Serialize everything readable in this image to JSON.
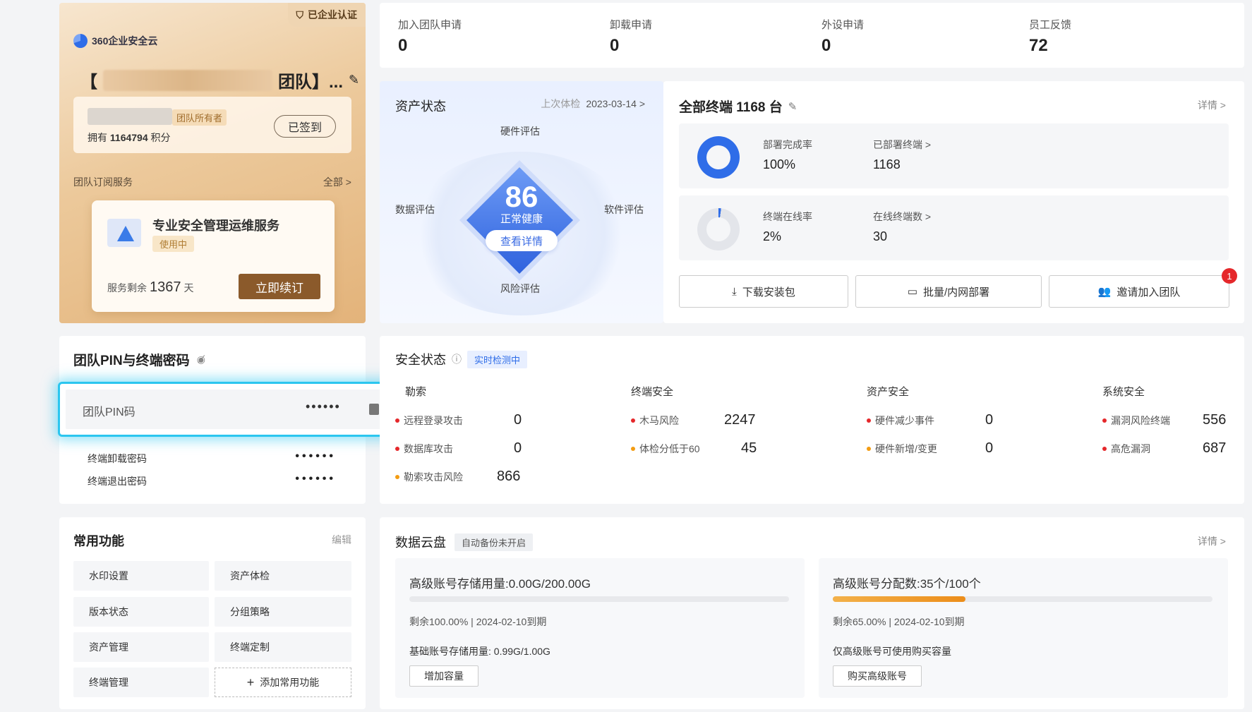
{
  "team": {
    "badge": "已企业认证",
    "logo_text": "360企业安全云",
    "name_suffix": "团队】...",
    "owner_tag": "团队所有者",
    "points_prefix": "拥有",
    "points_value": "1164794",
    "points_suffix": "积分",
    "signed_label": "已签到",
    "subscription_label": "团队订阅服务",
    "subscription_all": "全部 >",
    "service_title": "专业安全管理运维服务",
    "service_status": "使用中",
    "service_remain_prefix": "服务剩余",
    "service_remain_days": "1367",
    "service_remain_suffix": "天",
    "renew_label": "立即续订"
  },
  "top_stats": [
    {
      "label": "加入团队申请",
      "value": "0"
    },
    {
      "label": "卸载申请",
      "value": "0"
    },
    {
      "label": "外设申请",
      "value": "0"
    },
    {
      "label": "员工反馈",
      "value": "72"
    }
  ],
  "asset": {
    "title": "资产状态",
    "last_check_label": "上次体检",
    "last_check_date": "2023-03-14 >",
    "score": "86",
    "health": "正常健康",
    "detail_label": "查看详情",
    "axis_top": "硬件评估",
    "axis_left": "数据评估",
    "axis_right": "软件评估",
    "axis_bottom": "风险评估"
  },
  "terminals": {
    "title": "全部终端 1168 台",
    "detail": "详情 >",
    "deploy_rate_label": "部署完成率",
    "deploy_rate": "100%",
    "deployed_label": "已部署终端 >",
    "deployed": "1168",
    "online_rate_label": "终端在线率",
    "online_rate": "2%",
    "online_label": "在线终端数 >",
    "online": "30",
    "btn_download": "下载安装包",
    "btn_batch": "批量/内网部署",
    "btn_invite": "邀请加入团队",
    "invite_badge": "1",
    "colors": {
      "deploy": "#2f6de8",
      "online": "#2f6de8"
    }
  },
  "pin": {
    "title": "团队PIN与终端密码",
    "pin_label": "团队PIN码",
    "pin_value": "••••••",
    "uninstall_label": "终端卸载密码",
    "uninstall_value": "••••••",
    "exit_label": "终端退出密码",
    "exit_value": "••••••"
  },
  "security": {
    "title": "安全状态",
    "tag": "实时检测中",
    "columns": [
      {
        "head": "勒索",
        "items": [
          {
            "label": "远程登录攻击",
            "value": "0",
            "color": "#e5282b"
          },
          {
            "label": "数据库攻击",
            "value": "0",
            "color": "#e5282b"
          },
          {
            "label": "勒索攻击风险",
            "value": "866",
            "color": "#f39c12"
          }
        ]
      },
      {
        "head": "终端安全",
        "items": [
          {
            "label": "木马风险",
            "value": "2247",
            "color": "#e5282b"
          },
          {
            "label": "体检分低于60",
            "value": "45",
            "color": "#f39c12"
          }
        ]
      },
      {
        "head": "资产安全",
        "items": [
          {
            "label": "硬件减少事件",
            "value": "0",
            "color": "#e5282b"
          },
          {
            "label": "硬件新增/变更",
            "value": "0",
            "color": "#f39c12"
          }
        ]
      },
      {
        "head": "系统安全",
        "items": [
          {
            "label": "漏洞风险终端",
            "value": "556",
            "color": "#e5282b"
          },
          {
            "label": "高危漏洞",
            "value": "687",
            "color": "#e5282b"
          }
        ]
      }
    ]
  },
  "functions": {
    "title": "常用功能",
    "edit": "编辑",
    "items": [
      "水印设置",
      "资产体检",
      "版本状态",
      "分组策略",
      "资产管理",
      "终端定制",
      "终端管理"
    ],
    "add_label": "添加常用功能"
  },
  "cloud": {
    "title": "数据云盘",
    "tag": "自动备份未开启",
    "detail": "详情 >",
    "left": {
      "title": "高级账号存储用量:0.00G/200.00G",
      "progress": 0,
      "sub_a": "剩余100.00%",
      "sub_b": "2024-02-10到期",
      "line2": "基础账号存储用量: 0.99G/1.00G",
      "button": "增加容量"
    },
    "right": {
      "title": "高级账号分配数:35个/100个",
      "progress": 0.35,
      "sub_a": "剩余65.00%",
      "sub_b": "2024-02-10到期",
      "line2": "仅高级账号可使用购买容量",
      "button": "购买高级账号"
    }
  }
}
